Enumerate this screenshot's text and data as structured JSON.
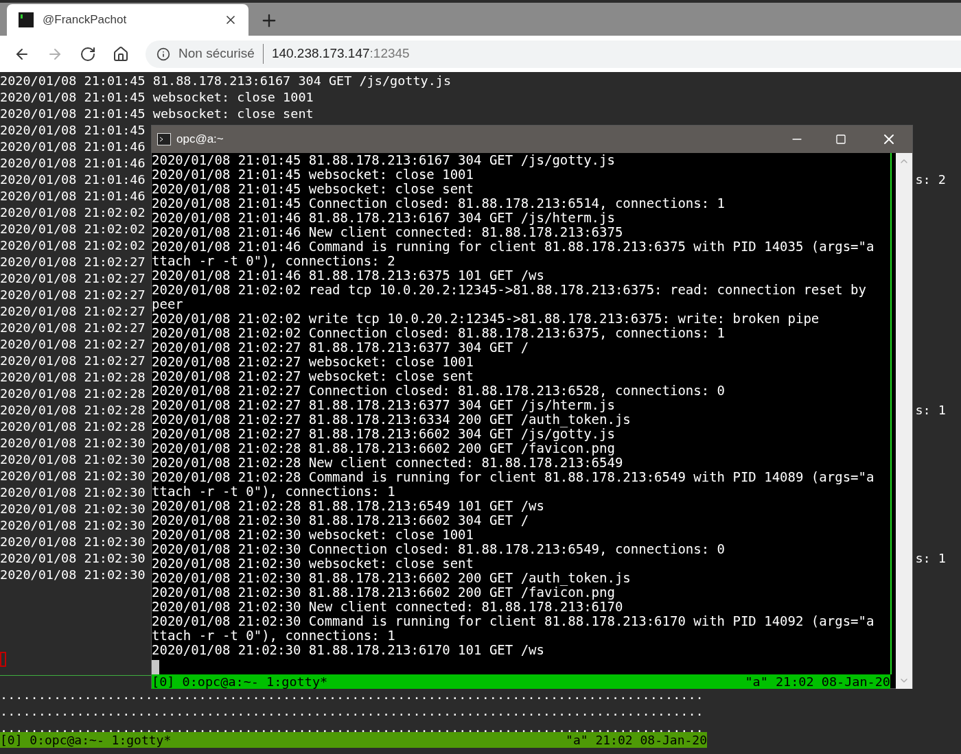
{
  "browser": {
    "tab": {
      "title": "@FranckPachot",
      "selected": true
    },
    "nav_buttons": [
      {
        "kind": "back",
        "disabled": false
      },
      {
        "kind": "forward",
        "disabled": true
      },
      {
        "kind": "reload",
        "disabled": false
      },
      {
        "kind": "home",
        "disabled": false
      }
    ],
    "address": {
      "security_label": "Non sécurisé",
      "host": "140.238.173.147",
      "port": ":12345"
    }
  },
  "background_terminal": {
    "lines": [
      {
        "text": "2020/01/08 21:01:45 81.88.178.213:6167 304 GET /js/gotty.js"
      },
      {
        "text": "2020/01/08 21:01:45 websocket: close 1001"
      },
      {
        "text": "2020/01/08 21:01:45 websocket: close sent"
      },
      {
        "text": "2020/01/08 21:01:45"
      },
      {
        "text": "2020/01/08 21:01:46"
      },
      {
        "text": "2020/01/08 21:01:46"
      },
      {
        "text": "2020/01/08 21:01:46",
        "right": "s: 2"
      },
      {
        "text": "2020/01/08 21:01:46"
      },
      {
        "text": "2020/01/08 21:02:02"
      },
      {
        "text": "2020/01/08 21:02:02"
      },
      {
        "text": "2020/01/08 21:02:02"
      },
      {
        "text": "2020/01/08 21:02:27"
      },
      {
        "text": "2020/01/08 21:02:27"
      },
      {
        "text": "2020/01/08 21:02:27"
      },
      {
        "text": "2020/01/08 21:02:27"
      },
      {
        "text": "2020/01/08 21:02:27"
      },
      {
        "text": "2020/01/08 21:02:27"
      },
      {
        "text": "2020/01/08 21:02:27"
      },
      {
        "text": "2020/01/08 21:02:28"
      },
      {
        "text": "2020/01/08 21:02:28"
      },
      {
        "text": "2020/01/08 21:02:28",
        "right": "s: 1"
      },
      {
        "text": "2020/01/08 21:02:28"
      },
      {
        "text": "2020/01/08 21:02:30"
      },
      {
        "text": "2020/01/08 21:02:30"
      },
      {
        "text": "2020/01/08 21:02:30"
      },
      {
        "text": "2020/01/08 21:02:30"
      },
      {
        "text": "2020/01/08 21:02:30"
      },
      {
        "text": "2020/01/08 21:02:30"
      },
      {
        "text": "2020/01/08 21:02:30"
      },
      {
        "text": "2020/01/08 21:02:30",
        "right": "s: 1"
      },
      {
        "text": "2020/01/08 21:02:30"
      }
    ],
    "dotted_rows": [
      "............................................................................................",
      "............................................................................................",
      "............................................................................................"
    ],
    "status_bar": {
      "left": "[0] 0:opc@a:~- 1:gotty*",
      "right": "\"a\" 21:02 08-Jan-20"
    }
  },
  "window": {
    "title": "opc@a:~",
    "lines": [
      "2020/01/08 21:01:45 81.88.178.213:6167 304 GET /js/gotty.js",
      "2020/01/08 21:01:45 websocket: close 1001",
      "2020/01/08 21:01:45 websocket: close sent",
      "2020/01/08 21:01:45 Connection closed: 81.88.178.213:6514, connections: 1",
      "2020/01/08 21:01:46 81.88.178.213:6167 304 GET /js/hterm.js",
      "2020/01/08 21:01:46 New client connected: 81.88.178.213:6375",
      "2020/01/08 21:01:46 Command is running for client 81.88.178.213:6375 with PID 14035 (args=\"a",
      "ttach -r -t 0\"), connections: 2",
      "2020/01/08 21:01:46 81.88.178.213:6375 101 GET /ws",
      "2020/01/08 21:02:02 read tcp 10.0.20.2:12345->81.88.178.213:6375: read: connection reset by",
      "peer",
      "2020/01/08 21:02:02 write tcp 10.0.20.2:12345->81.88.178.213:6375: write: broken pipe",
      "2020/01/08 21:02:02 Connection closed: 81.88.178.213:6375, connections: 1",
      "2020/01/08 21:02:27 81.88.178.213:6377 304 GET /",
      "2020/01/08 21:02:27 websocket: close 1001",
      "2020/01/08 21:02:27 websocket: close sent",
      "2020/01/08 21:02:27 Connection closed: 81.88.178.213:6528, connections: 0",
      "2020/01/08 21:02:27 81.88.178.213:6377 304 GET /js/hterm.js",
      "2020/01/08 21:02:27 81.88.178.213:6334 200 GET /auth_token.js",
      "2020/01/08 21:02:27 81.88.178.213:6602 304 GET /js/gotty.js",
      "2020/01/08 21:02:28 81.88.178.213:6602 200 GET /favicon.png",
      "2020/01/08 21:02:28 New client connected: 81.88.178.213:6549",
      "2020/01/08 21:02:28 Command is running for client 81.88.178.213:6549 with PID 14089 (args=\"a",
      "ttach -r -t 0\"), connections: 1",
      "2020/01/08 21:02:28 81.88.178.213:6549 101 GET /ws",
      "2020/01/08 21:02:30 81.88.178.213:6602 304 GET /",
      "2020/01/08 21:02:30 websocket: close 1001",
      "2020/01/08 21:02:30 Connection closed: 81.88.178.213:6549, connections: 0",
      "2020/01/08 21:02:30 websocket: close sent",
      "2020/01/08 21:02:30 81.88.178.213:6602 200 GET /auth_token.js",
      "2020/01/08 21:02:30 81.88.178.213:6602 200 GET /favicon.png",
      "2020/01/08 21:02:30 New client connected: 81.88.178.213:6170",
      "2020/01/08 21:02:30 Command is running for client 81.88.178.213:6170 with PID 14092 (args=\"a",
      "ttach -r -t 0\"), connections: 1",
      "2020/01/08 21:02:30 81.88.178.213:6170 101 GET /ws"
    ],
    "status_bar": {
      "left": "[0] 0:opc@a:~- 1:gotty*",
      "right": "\"a\" 21:02 08-Jan-20"
    }
  }
}
